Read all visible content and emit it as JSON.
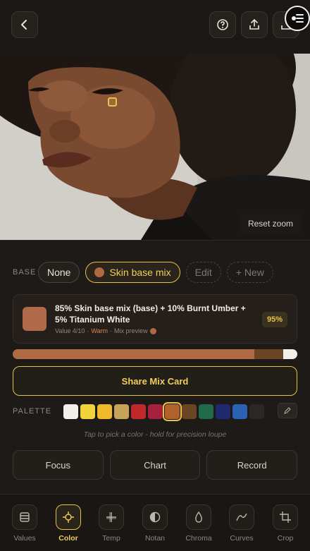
{
  "topbar": {
    "back_icon": "chevron-left-icon",
    "help_icon": "question-circle-icon",
    "share_icon": "upload-icon",
    "export_icon": "export-icon",
    "fab_icon": "menu-lines-icon"
  },
  "photo": {
    "reset_zoom_label": "Reset zoom"
  },
  "base": {
    "label": "BASE",
    "chips": [
      "None",
      "Skin base mix",
      "Edit",
      "+ New"
    ]
  },
  "mix": {
    "title": "85% Skin base mix (base) + 10% Burnt Umber + 5% Titanium White",
    "meta_value": "Value 4/10",
    "meta_sep1": "·",
    "meta_temp": "Warm",
    "meta_sep2": "·",
    "meta_preview": "Mix preview",
    "match_pct": "95%",
    "swatch_color": "#b06a4a",
    "bar_fractions": [
      0.85,
      0.1,
      0.05
    ]
  },
  "share": {
    "label": "Share Mix Card"
  },
  "palette": {
    "label": "PALETTE",
    "colors": [
      "#f3f0ea",
      "#f2d23a",
      "#efb92a",
      "#c6a35a",
      "#c0282b",
      "#a61f3c",
      "#b0622d",
      "#6b4424",
      "#1f6a4b",
      "#1f2a6e",
      "#2a62b5",
      "#2a2826"
    ],
    "selected_index": 6,
    "edit_icon": "pencil-icon"
  },
  "hint": "Tap to pick a color - hold for precision loupe",
  "actions": [
    "Focus",
    "Chart",
    "Record"
  ],
  "nav": {
    "items": [
      {
        "label": "Values",
        "icon": "layers-icon"
      },
      {
        "label": "Color",
        "icon": "crosshair-icon"
      },
      {
        "label": "Temp",
        "icon": "grid-plus-icon"
      },
      {
        "label": "Notan",
        "icon": "half-circle-icon"
      },
      {
        "label": "Chroma",
        "icon": "droplet-icon"
      },
      {
        "label": "Curves",
        "icon": "curve-icon"
      },
      {
        "label": "Crop",
        "icon": "crop-icon"
      }
    ],
    "active_index": 1
  },
  "colors": {
    "accent": "#e8c244",
    "background": "#1b1815",
    "warm": "#d9884d"
  }
}
